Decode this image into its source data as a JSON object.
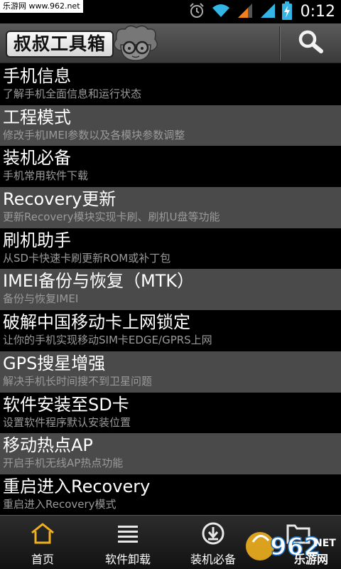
{
  "status_bar": {
    "watermark": "乐游网 www.962.net",
    "time": "0:12",
    "icons": [
      "alarm-icon",
      "wifi-icon",
      "signal-icon",
      "signal-icon",
      "battery-charging-icon"
    ]
  },
  "header": {
    "app_title": "叔叔工具箱",
    "search_icon": "search-icon"
  },
  "menu": {
    "items": [
      {
        "title": "手机信息",
        "desc": "了解手机全面信息和运行状态"
      },
      {
        "title": "工程模式",
        "desc": "修改手机IMEI参数以及各模块参数调整"
      },
      {
        "title": "装机必备",
        "desc": "手机常用软件下载"
      },
      {
        "title": "Recovery更新",
        "desc": "更新Recovery模块实现卡刷、刷机U盘等功能"
      },
      {
        "title": "刷机助手",
        "desc": "从SD卡快速卡刷更新ROM或补丁包"
      },
      {
        "title": "IMEI备份与恢复（MTK）",
        "desc": "备份与恢复IMEI"
      },
      {
        "title": "破解中国移动卡上网锁定",
        "desc": "让你的手机实现移动SIM卡EDGE/GPRS上网"
      },
      {
        "title": "GPS搜星增强",
        "desc": "解决手机长时间搜不到卫星问题"
      },
      {
        "title": "软件安装至SD卡",
        "desc": "设置软件程序默认安装位置"
      },
      {
        "title": "移动热点AP",
        "desc": "开启手机无线AP热点功能"
      },
      {
        "title": "重启进入Recovery",
        "desc": "重启进入Recovery模式"
      }
    ]
  },
  "bottom_nav": {
    "items": [
      {
        "label": "首页",
        "icon": "home-icon"
      },
      {
        "label": "软件卸载",
        "icon": "list-icon"
      },
      {
        "label": "装机必备",
        "icon": "download-icon"
      },
      {
        "label": "",
        "icon": "folder-icon"
      }
    ]
  },
  "watermark_br": {
    "brand_number": "962",
    "brand_suffix": "NET",
    "brand_name": "乐游网"
  },
  "colors": {
    "accent_home": "#f0b020",
    "row_alt": "#4a4a4a",
    "desc_text": "#9a9a9a",
    "status_blue": "#33b5e5",
    "status_orange": "#f08020"
  }
}
